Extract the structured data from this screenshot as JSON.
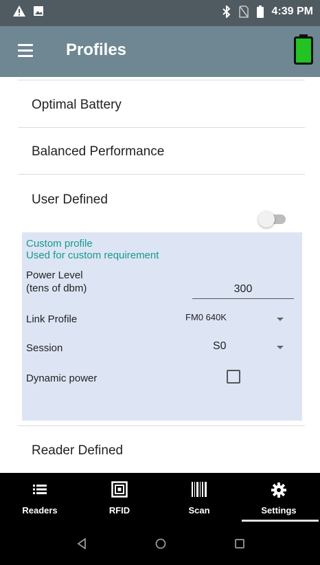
{
  "status_bar": {
    "time": "4:39 PM",
    "left_icons": [
      "warning-icon",
      "image-icon"
    ],
    "right_icons": [
      "bluetooth-icon",
      "no-sim-icon",
      "battery-icon"
    ]
  },
  "app_bar": {
    "title": "Profiles",
    "battery_color": "#22c322"
  },
  "profiles": {
    "optimal_battery": "Optimal Battery",
    "balanced_performance": "Balanced Performance",
    "user_defined": "User Defined",
    "user_defined_enabled": false,
    "reader_defined": "Reader Defined"
  },
  "custom_profile": {
    "title": "Custom profile",
    "subtitle": "Used for custom requirement",
    "power_level_label_1": "Power Level",
    "power_level_label_2": "(tens of dbm)",
    "power_level_value": "300",
    "link_profile_label": "Link Profile",
    "link_profile_value": "FM0 640K",
    "session_label": "Session",
    "session_value": "S0",
    "dynamic_power_label": "Dynamic power",
    "dynamic_power_checked": false,
    "panel_color": "#dde5f4",
    "accent_color": "#18988f"
  },
  "bottom_nav": {
    "items": [
      {
        "label": "Readers",
        "icon": "list-icon"
      },
      {
        "label": "RFID",
        "icon": "rfid-tag-icon"
      },
      {
        "label": "Scan",
        "icon": "barcode-icon"
      },
      {
        "label": "Settings",
        "icon": "gear-icon"
      }
    ],
    "active": "Settings"
  },
  "system_nav": {
    "icons": [
      "back-icon",
      "home-icon",
      "recents-icon"
    ]
  }
}
